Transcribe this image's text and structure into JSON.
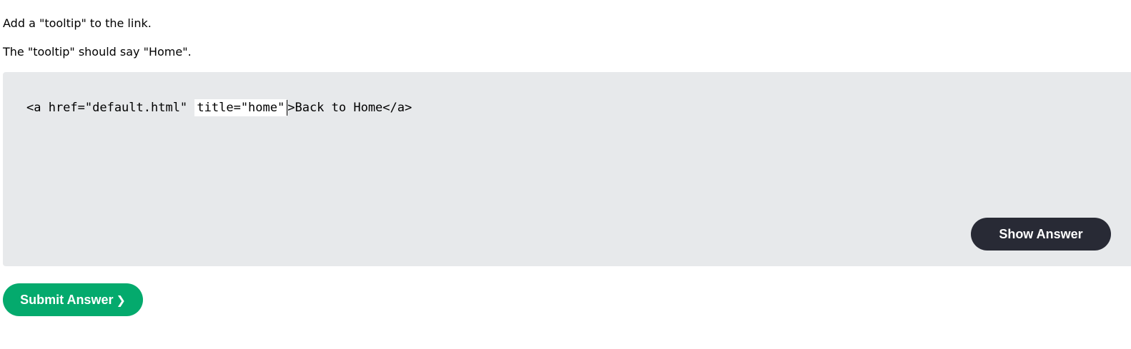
{
  "instructions": {
    "line1": "Add a \"tooltip\" to the link.",
    "line2": "The \"tooltip\" should say \"Home\"."
  },
  "code": {
    "prefix": "<a href=\"default.html\" ",
    "input_value": "title=\"home\"",
    "suffix": ">Back to Home</a>"
  },
  "buttons": {
    "show_answer": "Show Answer",
    "submit_answer": "Submit Answer",
    "submit_chevron": "❯"
  },
  "colors": {
    "panel_bg": "#e7e9eb",
    "show_answer_bg": "#282a35",
    "submit_bg": "#04aa6d"
  }
}
